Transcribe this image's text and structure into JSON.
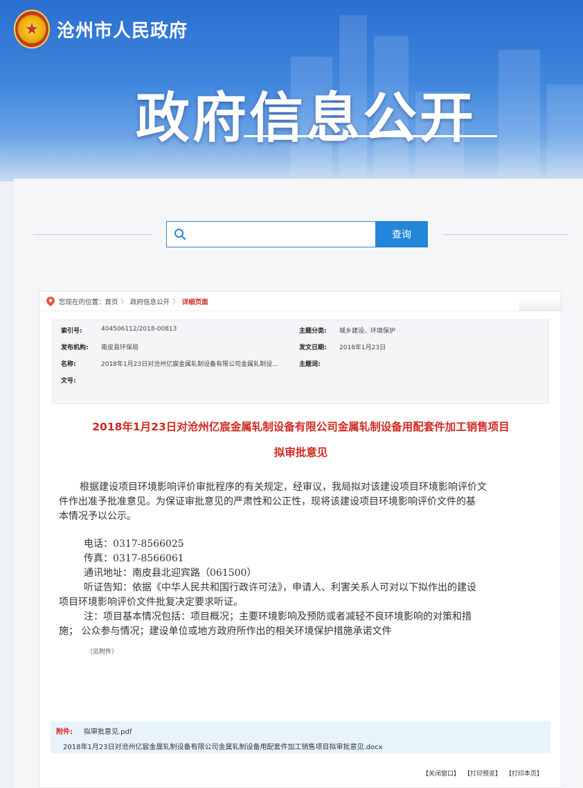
{
  "header": {
    "site_name": "沧州市人民政府",
    "banner_title": "政府信息公开"
  },
  "search": {
    "placeholder": "",
    "button_label": "查询"
  },
  "breadcrumb": {
    "prefix": "您现在的位置：",
    "items": [
      "首页",
      "政府信息公开"
    ],
    "separator": "〉",
    "current": "详细页面"
  },
  "meta": {
    "index_label": "索引号:",
    "index_value": "404506112/2018-00813",
    "category_label": "主题分类:",
    "category_value": "城乡建设、环境保护",
    "publisher_label": "发布机构:",
    "publisher_value": "南皮县环保局",
    "date_label": "发文日期:",
    "date_value": "2018年1月23日",
    "name_label": "名称:",
    "name_value": "2018年1月23日对沧州亿宸金属轧制设备有限公司金属轧制设...",
    "keyword_label": "主题词:",
    "keyword_value": "",
    "docno_label": "文号:",
    "docno_value": ""
  },
  "document": {
    "title_line1": "2018年1月23日对沧州亿宸金属轧制设备有限公司金属轧制设备用配套件加工销售项目",
    "title_line2": "拟审批意见",
    "para1_l1": "根据建设项目环境影响评价审批程序的有关规定，经审议，我局拟对该建设项目环境影响评价文",
    "para1_l2": "件作出准予批准意见。为保证审批意见的严肃性和公正性，现将该建设项目环境影响评价文件的基",
    "para1_l3": "本情况予以公示。",
    "phone": "电话：0317-8566025",
    "fax": "传真：0317-8566061",
    "address": "通讯地址：南皮县北迎宾路（061500）",
    "hearing_l1": "听证告知：依据《中华人民共和国行政许可法》，申请人、利害关系人可对以下拟作出的建设",
    "hearing_l2": "项目环境影响评价文件批复决定要求听证。",
    "note_l1": "注：项目基本情况包括：项目概况；主要环境影响及预防或者减轻不良环境影响的对策和措",
    "note_l2": "施；  公众参与情况；建设单位或地方政府所作出的相关环境保护措施承诺文件",
    "see_attachment": "（见附件）"
  },
  "attachments": {
    "label": "附件:",
    "files": [
      "拟审批意见.pdf",
      "2018年1月23日对沧州亿宸金属轧制设备有限公司金属轧制设备用配套件加工销售项目拟审批意见.docx"
    ]
  },
  "actions": {
    "close": "【关闭窗口】",
    "preview": "【打印预览】",
    "print": "【打印本页】"
  },
  "colors": {
    "accent_red": "#d1281f",
    "search_blue": "#2486d9",
    "banner_blue": "#2a6fcf"
  }
}
